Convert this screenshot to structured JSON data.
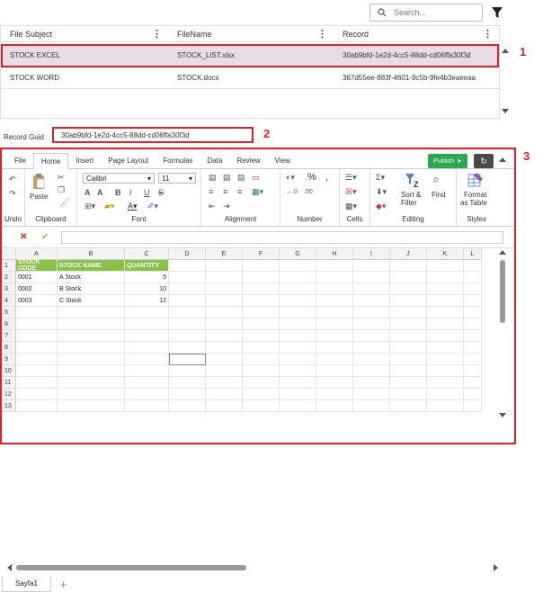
{
  "search": {
    "placeholder": "Search..."
  },
  "grid": {
    "columns": [
      "File Subject",
      "FileName",
      "Record"
    ],
    "rows": [
      {
        "subject": "STOCK EXCEL",
        "filename": "STOCK_LIST.xlsx",
        "record": "30ab9bfd-1e2d-4cc5-88dd-cd06ffa30f3d"
      },
      {
        "subject": "STOCK WORD",
        "filename": "STOCK.docx",
        "record": "367d55ee-883f-4601-9c5b-9fe4b3eaeeaa"
      }
    ]
  },
  "callouts": {
    "one": "1",
    "two": "2",
    "three": "3"
  },
  "record_guid": {
    "label": "Record Guid",
    "value": "30ab9bfd-1e2d-4cc5-88dd-cd06ffa30f3d"
  },
  "spreadsheet": {
    "tabs": [
      "File",
      "Home",
      "Insert",
      "Page Layout",
      "Formulas",
      "Data",
      "Review",
      "View"
    ],
    "publish_label": "Publish",
    "ribbon": {
      "undo": "Undo",
      "clipboard": "Clipboard",
      "paste": "Paste",
      "font": "Font",
      "font_name": "Calibri",
      "font_size": "11",
      "alignment": "Alignment",
      "number": "Number",
      "cells": "Cells",
      "editing": "Editing",
      "sort_filter": "Sort &",
      "filter": "Filter",
      "find": "Find",
      "styles": "Styles",
      "format_as": "Format",
      "as_table": "as Table"
    },
    "columns": [
      "A",
      "B",
      "C",
      "D",
      "E",
      "F",
      "G",
      "H",
      "I",
      "J",
      "K",
      "L"
    ],
    "rows": [
      "1",
      "2",
      "3",
      "4",
      "5",
      "6",
      "7",
      "8",
      "9",
      "10",
      "11",
      "12",
      "13"
    ],
    "data": [
      [
        "STOCK CODE",
        "STOCK NAME",
        "QUANTITY"
      ],
      [
        "0001",
        "A Stock",
        "5"
      ],
      [
        "0002",
        "B Stock",
        "10"
      ],
      [
        "0003",
        "C Stock",
        "12"
      ]
    ],
    "sheet_tab": "Sayfa1",
    "add_sheet": "+"
  }
}
